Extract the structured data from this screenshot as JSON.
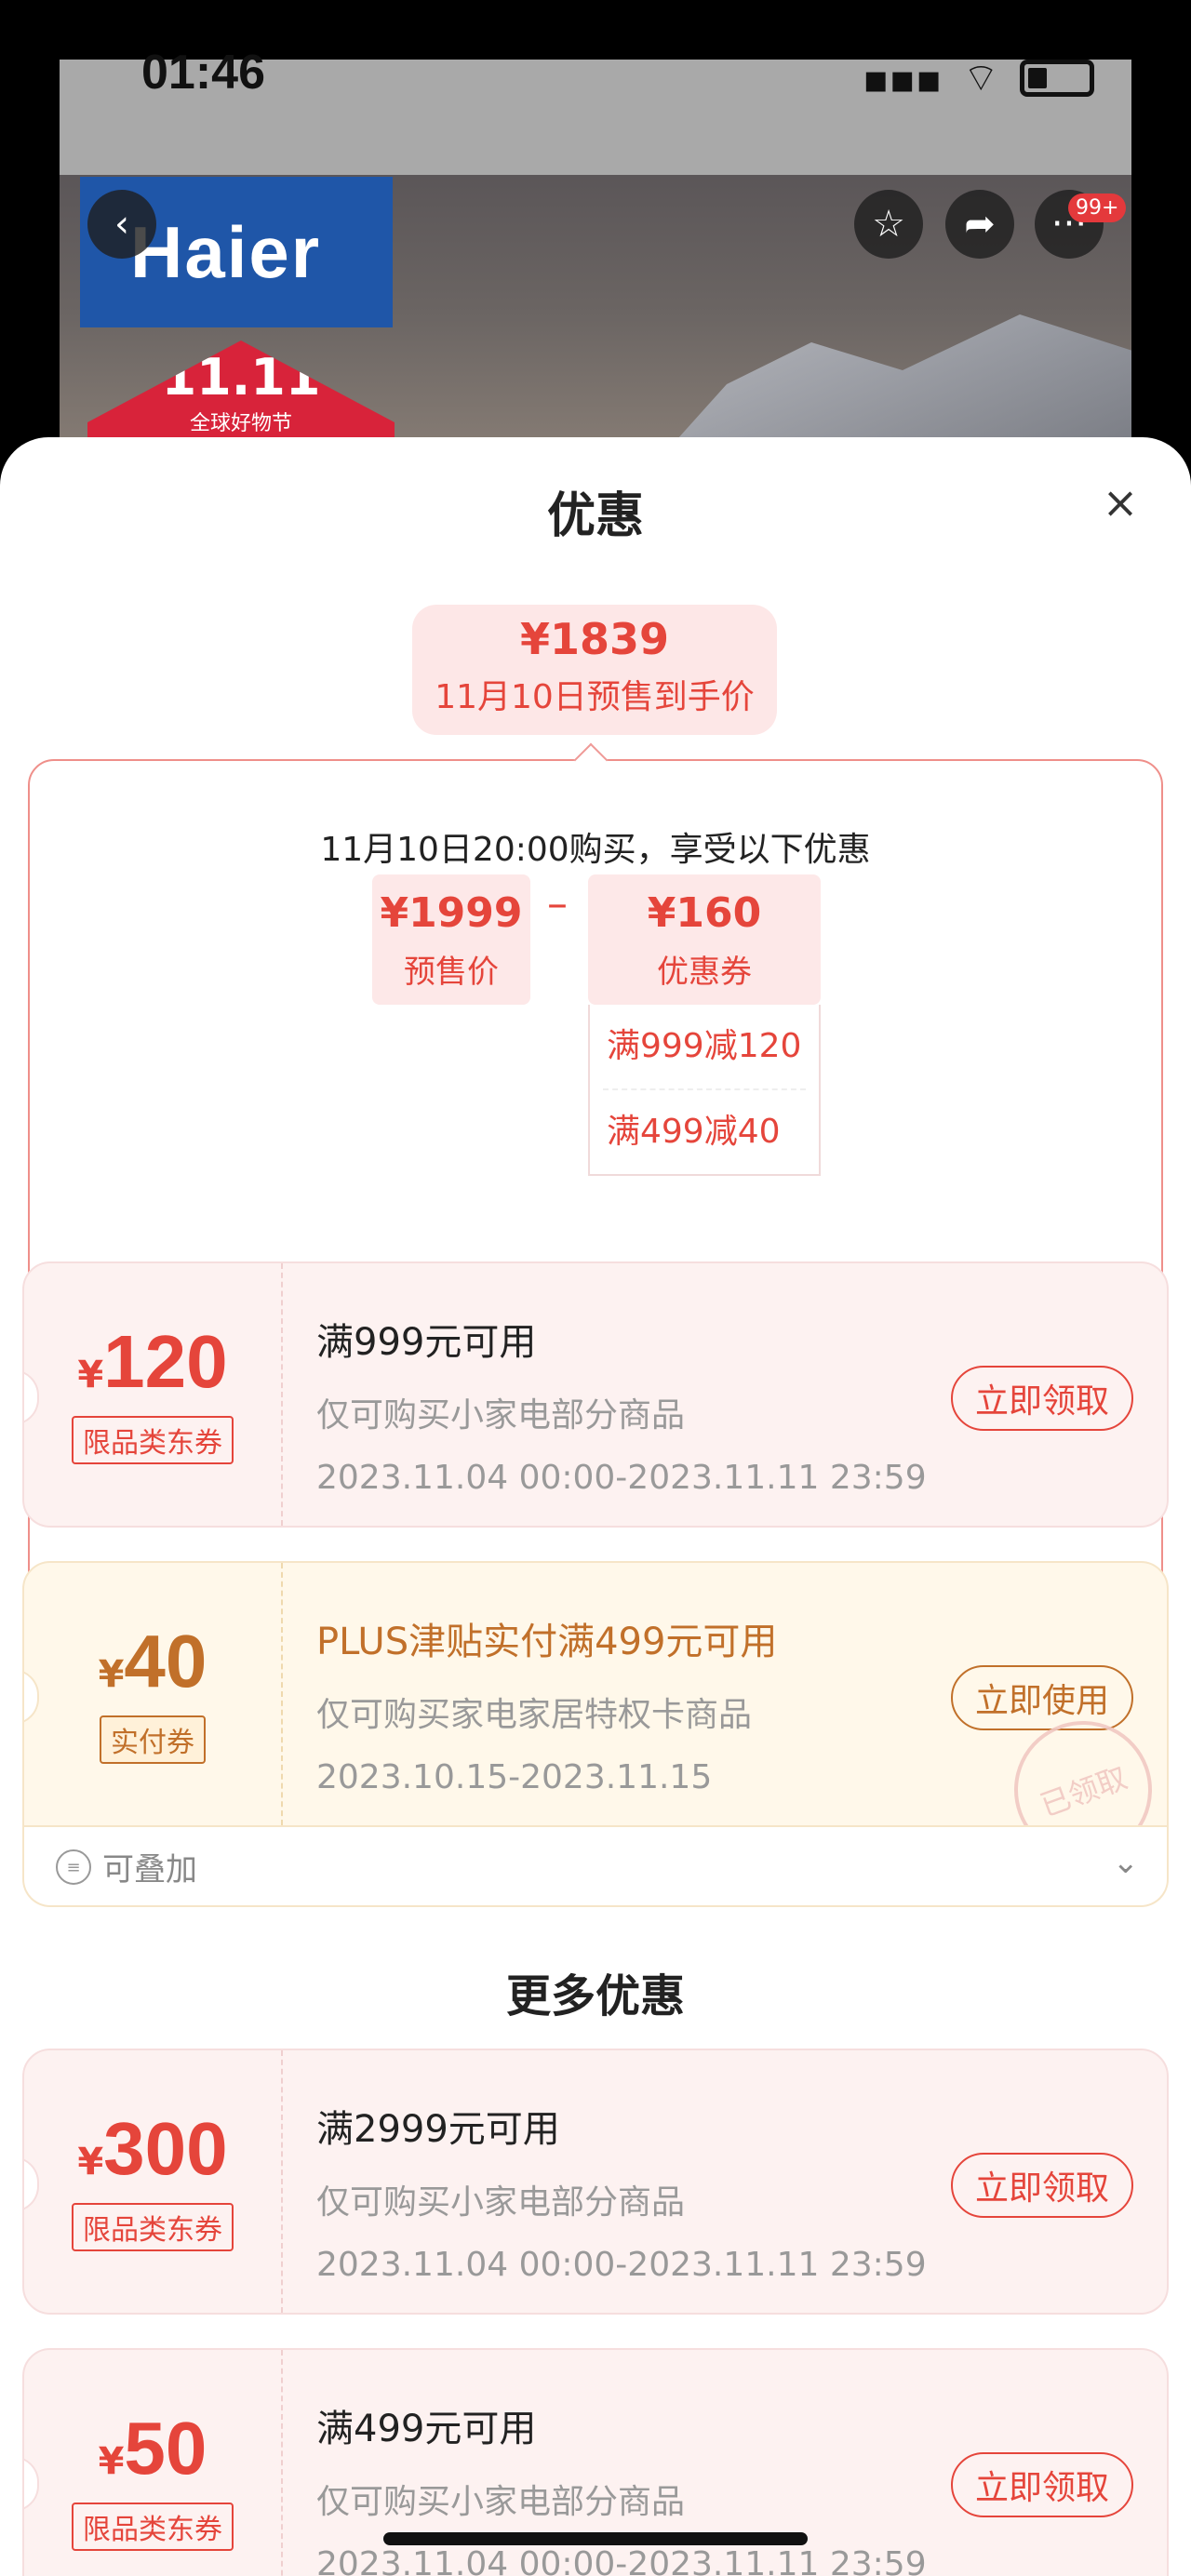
{
  "status_bar": {
    "time": "01:46"
  },
  "hero": {
    "brand": "Haier",
    "promo_big": "11.11",
    "promo_small": "全球好物节",
    "notification_badge": "99+"
  },
  "sheet": {
    "title": "优惠",
    "price_pill": {
      "price": "¥1839",
      "label": "11月10日预售到手价"
    },
    "detail": {
      "heading": "11月10日20:00购买，享受以下优惠",
      "presale": {
        "value": "¥1999",
        "label": "预售价"
      },
      "operator": "–",
      "coupon_total": {
        "value": "¥160",
        "label": "优惠券"
      },
      "coupon_items": [
        "满999减120",
        "满499减40"
      ]
    },
    "coupons": [
      {
        "currency": "¥",
        "amount": "120",
        "tag": "限品类东券",
        "condition": "满999元可用",
        "scope": "仅可购买小家电部分商品",
        "period": "2023.11.04 00:00-2023.11.11 23:59",
        "button": "立即领取"
      },
      {
        "currency": "¥",
        "amount": "40",
        "tag": "实付券",
        "condition": "PLUS津贴实付满499元可用",
        "scope": "仅可购买家电家居特权卡商品",
        "period": "2023.10.15-2023.11.15",
        "button": "立即使用",
        "stamp": "已领取"
      }
    ],
    "stack": {
      "label": "可叠加"
    },
    "more_title": "更多优惠",
    "more_coupons": [
      {
        "currency": "¥",
        "amount": "300",
        "tag": "限品类东券",
        "condition": "满2999元可用",
        "scope": "仅可购买小家电部分商品",
        "period": "2023.11.04 00:00-2023.11.11 23:59",
        "button": "立即领取"
      },
      {
        "currency": "¥",
        "amount": "50",
        "tag": "限品类东券",
        "condition": "满499元可用",
        "scope": "仅可购买小家电部分商品",
        "period": "2023.11.04 00:00-2023.11.11 23:59",
        "button": "立即领取"
      }
    ]
  }
}
